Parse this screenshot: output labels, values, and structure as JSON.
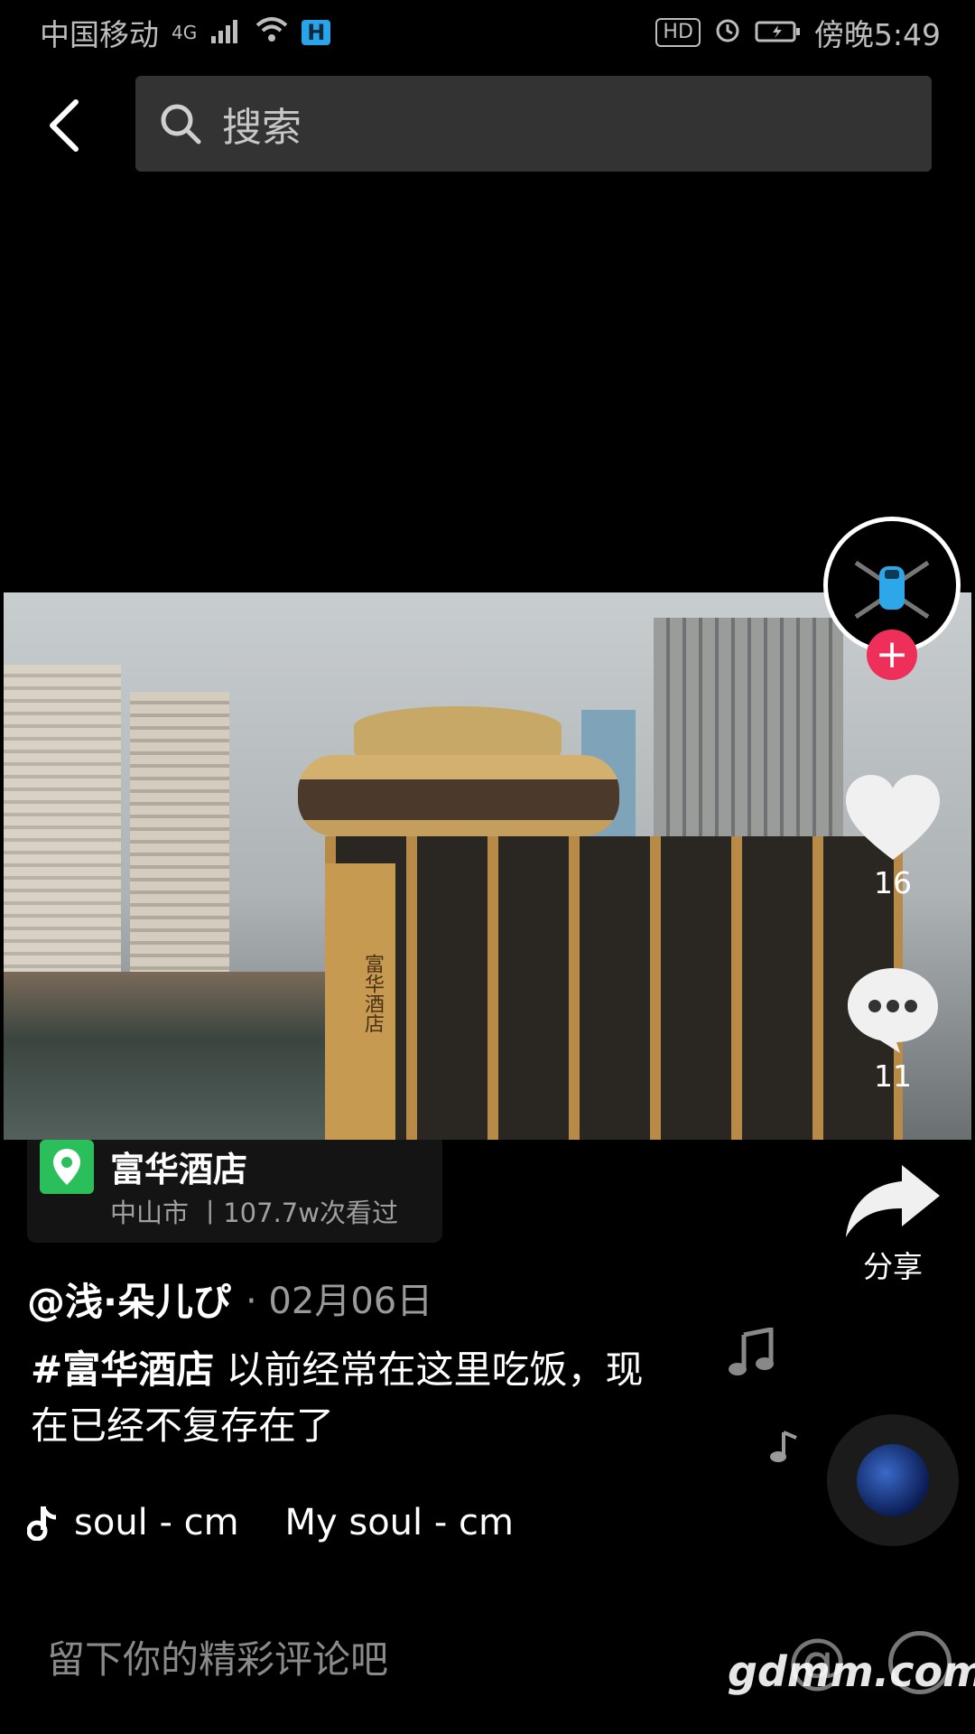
{
  "status_bar": {
    "carrier": "中国移动",
    "network": "4G",
    "hd_badge": "HD",
    "time": "傍晚5:49"
  },
  "search": {
    "placeholder": "搜索"
  },
  "video": {
    "sign_text": "富华酒店"
  },
  "rail": {
    "likes": "16",
    "comments": "11",
    "share_label": "分享"
  },
  "location": {
    "name": "富华酒店",
    "detail": "中山市 丨107.7w次看过"
  },
  "post": {
    "author": "@浅·朵儿ぴ",
    "date": "· 02月06日",
    "hashtag": "#富华酒店",
    "text": " 以前经常在这里吃饭，现在已经不复存在了"
  },
  "music": {
    "ticker": "soul - cm    My soul - cm"
  },
  "comment": {
    "placeholder": "留下你的精彩评论吧",
    "at_icon": "@"
  },
  "watermark": "gdmm.com",
  "icons": [
    "back-arrow-icon",
    "search-icon",
    "heart-icon",
    "comment-icon",
    "share-icon",
    "music-note-icon",
    "location-pin-icon",
    "emoji-icon"
  ],
  "colors": {
    "follow": "#ee2f5a",
    "location_pin": "#2bbf5c"
  }
}
